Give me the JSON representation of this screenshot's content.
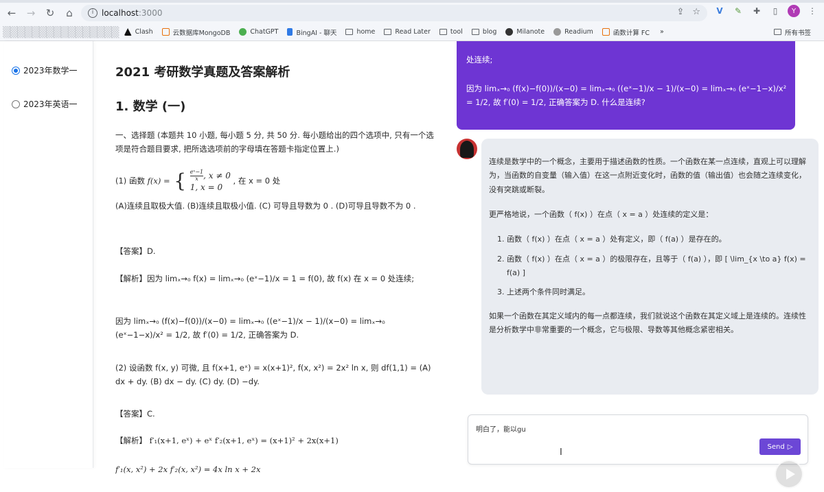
{
  "browser": {
    "url_host": "localhost",
    "url_port": ":3000",
    "bookmarks": [
      "Clash",
      "云数据库MongoDB",
      "ChatGPT",
      "BingAI - 聊天",
      "home",
      "Read Later",
      "tool",
      "blog",
      "Milanote",
      "Readium",
      "函数计算 FC"
    ],
    "more": "»",
    "all_bookmarks": "所有书签",
    "avatar_initial": "Y"
  },
  "sidebar": {
    "items": [
      {
        "label": "2023年数学一",
        "selected": true
      },
      {
        "label": "2023年英语一",
        "selected": false
      }
    ]
  },
  "doc": {
    "title": "2021 考研数学真题及答案解析",
    "section": "1. 数学 (一)",
    "intro": "一、选择题 (本题共 10 小题, 每小题 5 分, 共 50 分. 每小题给出的四个选项中, 只有一个选项是符合题目要求, 把所选选项前的字母填在答题卡指定位置上.)",
    "q1_prefix": "(1) 函数",
    "q1_fx": "f(x) =",
    "q1_case1_num": "eˣ−1",
    "q1_case1_den": "x",
    "q1_case1_cond": ", x ≠ 0",
    "q1_case2": "1, x = 0",
    "q1_suffix": ", 在 x = 0 处",
    "q1_options": "(A)连续且取极大值. (B)连续且取极小值. (C) 可导且导数为 0 . (D)可导且导数不为 0 .",
    "q1_answer": "【答案】D.",
    "q1_analysis_1": "【解析】因为 limₓ→₀ f(x) = limₓ→₀ (eˣ−1)/x = 1 = f(0), 故 f(x) 在 x = 0 处连续;",
    "q1_analysis_2": "因为 limₓ→₀ (f(x)−f(0))/(x−0) = limₓ→₀ ((eˣ−1)/x − 1)/(x−0) = limₓ→₀ (eˣ−1−x)/x² = 1/2, 故 f′(0) = 1/2, 正确答案为 D.",
    "q2_text": "(2) 设函数 f(x, y) 可微, 且 f(x+1, eˣ) = x(x+1)², f(x, x²) = 2x² ln x, 则 df(1,1) = (A) dx + dy. (B) dx − dy. (C) dy. (D) −dy.",
    "q2_answer": "【答案】C.",
    "q2_analysis_1": "【解析】 f′₁(x+1, eˣ) + eˣ f′₂(x+1, eˣ) = (x+1)² + 2x(x+1)",
    "q2_analysis_2": "f′₁(x, x²) + 2x f′₂(x, x²) = 4x ln x + 2x"
  },
  "chat": {
    "user_cut": "",
    "user_line1": "处连续;",
    "user_line2": "因为 limₓ→₀ (f(x)−f(0))/(x−0) = limₓ→₀ ((eˣ−1)/x − 1)/(x−0) = limₓ→₀ (eˣ−1−x)/x² = 1/2, 故 f′(0) = 1/2, 正确答案为 D. 什么是连续?",
    "bot_p1": "连续是数学中的一个概念，主要用于描述函数的性质。一个函数在某一点连续，直观上可以理解为，当函数的自变量（输入值）在这一点附近变化时，函数的值（输出值）也会随之连续变化，没有突跳或断裂。",
    "bot_p2": "更严格地说，一个函数（ f(x) ）在点（ x = a ）处连续的定义是：",
    "bot_list": [
      "函数（ f(x) ）在点（ x = a ）处有定义，即（ f(a) ）是存在的。",
      "函数（ f(x) ）在点（ x = a ）的极限存在，且等于（ f(a) ），即 [ \\lim_{x \\to a} f(x) = f(a) ]",
      "上述两个条件同时满足。"
    ],
    "bot_p3": "如果一个函数在其定义域内的每一点都连续，我们就说这个函数在其定义域上是连续的。连续性是分析数学中非常重要的一个概念，它与极限、导数等其他概念紧密相关。",
    "input_value": "明白了，能以gu",
    "send_label": "Send"
  }
}
